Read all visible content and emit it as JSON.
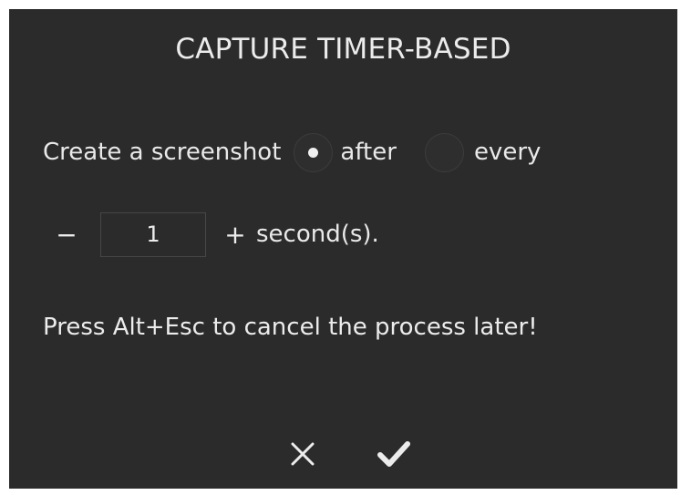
{
  "dialog": {
    "title": "CAPTURE TIMER-BASED",
    "prompt": "Create a screenshot",
    "mode_options": [
      {
        "label": "after",
        "selected": true
      },
      {
        "label": "every",
        "selected": false
      }
    ],
    "stepper": {
      "decrement_label": "−",
      "value": "1",
      "increment_label": "+",
      "unit": "second(s)."
    },
    "note": "Press Alt+Esc to cancel the process later!",
    "actions": {
      "cancel_icon": "close-icon",
      "confirm_icon": "check-icon"
    },
    "colors": {
      "background": "#2b2b2b",
      "text": "#ececec"
    }
  }
}
